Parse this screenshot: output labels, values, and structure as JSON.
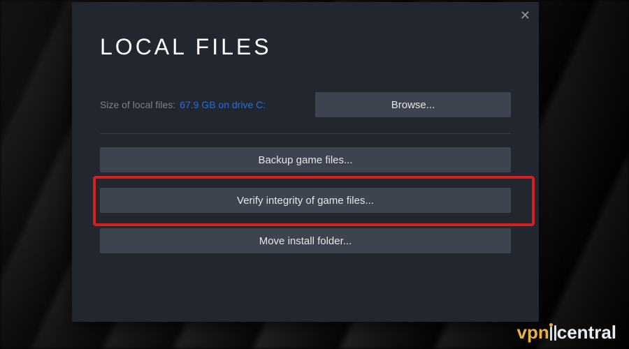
{
  "dialog": {
    "title": "LOCAL FILES",
    "size_label": "Size of local files:",
    "size_value": "67.9 GB on drive C:",
    "browse_label": "Browse...",
    "backup_label": "Backup game files...",
    "verify_label": "Verify integrity of game files...",
    "move_label": "Move install folder...",
    "close_glyph": "✕"
  },
  "watermark": {
    "part1": "vpn",
    "part2": "central"
  },
  "colors": {
    "dialog_bg": "#22262e",
    "button_bg": "#3d4450",
    "link_blue": "#2a6ed6",
    "callout_red": "#d61f1f",
    "wm_accent": "#eab040"
  }
}
